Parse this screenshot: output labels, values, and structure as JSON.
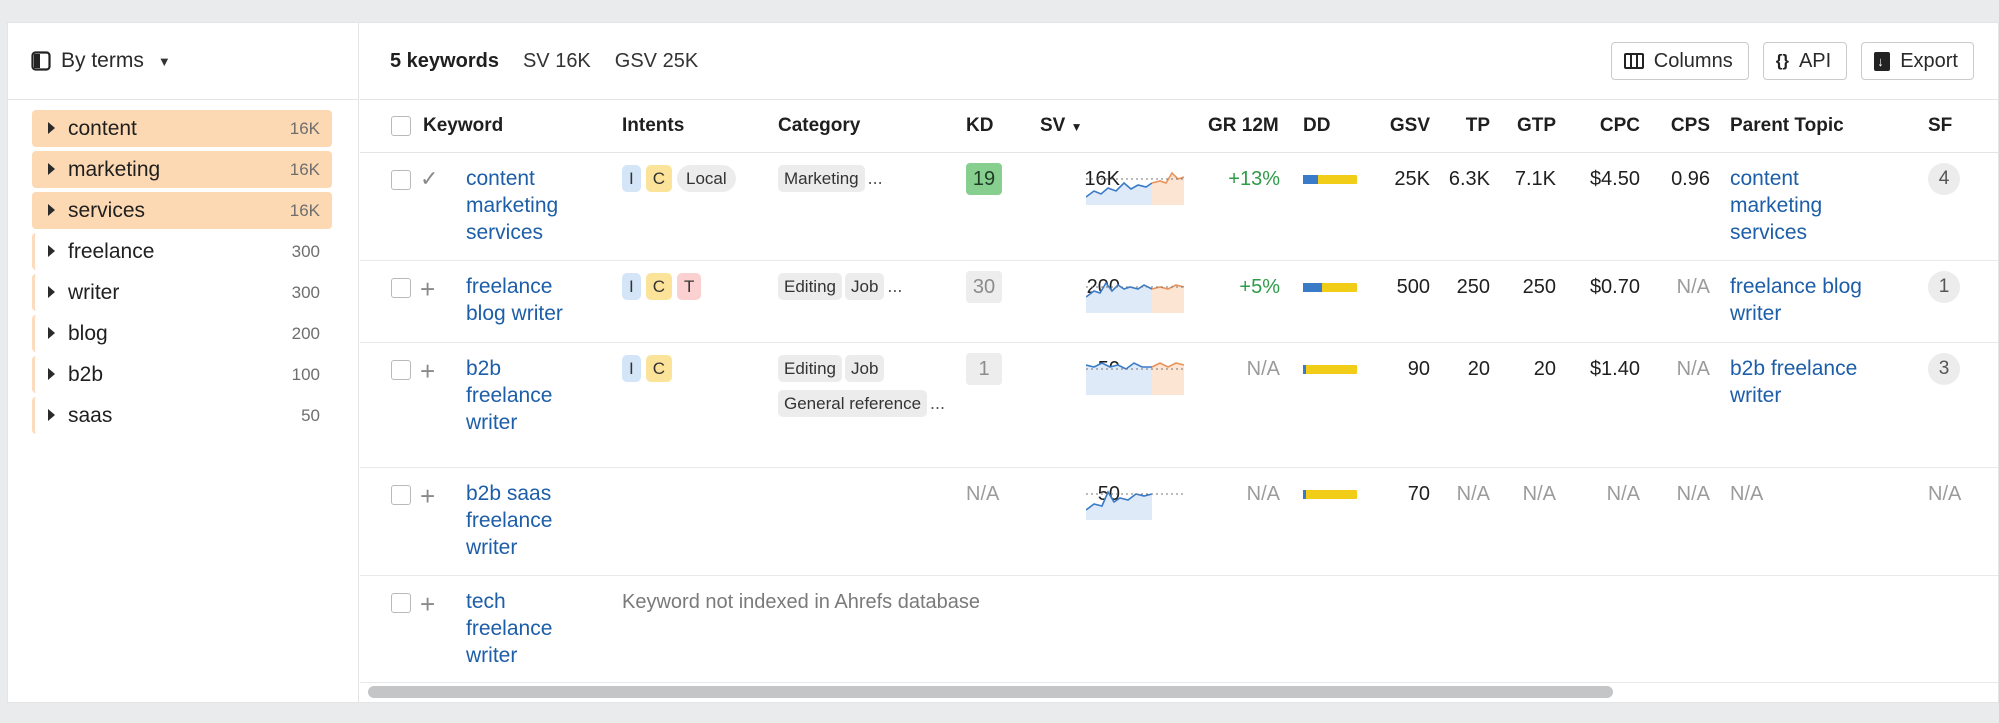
{
  "sidebar": {
    "view_label": "By terms",
    "terms": [
      {
        "name": "content",
        "count": "16K",
        "highlighted": true
      },
      {
        "name": "marketing",
        "count": "16K",
        "highlighted": true
      },
      {
        "name": "services",
        "count": "16K",
        "highlighted": true
      },
      {
        "name": "freelance",
        "count": "300",
        "highlighted": false
      },
      {
        "name": "writer",
        "count": "300",
        "highlighted": false
      },
      {
        "name": "blog",
        "count": "200",
        "highlighted": false
      },
      {
        "name": "b2b",
        "count": "100",
        "highlighted": false
      },
      {
        "name": "saas",
        "count": "50",
        "highlighted": false
      }
    ]
  },
  "header": {
    "keyword_count": "5 keywords",
    "sv_total": "SV 16K",
    "gsv_total": "GSV 25K",
    "buttons": {
      "columns": "Columns",
      "api": "API",
      "export": "Export"
    }
  },
  "columns": {
    "keyword": "Keyword",
    "intents": "Intents",
    "category": "Category",
    "kd": "KD",
    "sv": "SV",
    "gr": "GR 12M",
    "dd": "DD",
    "gsv": "GSV",
    "tp": "TP",
    "gtp": "GTP",
    "cpc": "CPC",
    "cps": "CPS",
    "parent": "Parent Topic",
    "sf": "SF"
  },
  "rows": [
    {
      "keyword": "content marketing services",
      "intents": [
        "I",
        "C",
        "Local"
      ],
      "categories": [
        "Marketing"
      ],
      "category_more": "...",
      "kd": "19",
      "sv": "16K",
      "gr": "+13%",
      "dd_blue_fraction": 0.27,
      "gsv": "25K",
      "tp": "6.3K",
      "gtp": "7.1K",
      "cpc": "$4.50",
      "cps": "0.96",
      "parent": "content marketing services",
      "sf": "4",
      "added": true
    },
    {
      "keyword": "freelance blog writer",
      "intents": [
        "I",
        "C",
        "T"
      ],
      "categories": [
        "Editing",
        "Job"
      ],
      "category_more": "...",
      "kd": "30",
      "sv": "200",
      "gr": "+5%",
      "dd_blue_fraction": 0.35,
      "gsv": "500",
      "tp": "250",
      "gtp": "250",
      "cpc": "$0.70",
      "cps": "N/A",
      "parent": "freelance blog writer",
      "sf": "1",
      "added": false
    },
    {
      "keyword": "b2b freelance writer",
      "intents": [
        "I",
        "C"
      ],
      "categories": [
        "Editing",
        "Job",
        "General reference"
      ],
      "category_more": "...",
      "kd": "1",
      "sv": "50",
      "gr": "N/A",
      "dd_blue_fraction": 0.05,
      "gsv": "90",
      "tp": "20",
      "gtp": "20",
      "cpc": "$1.40",
      "cps": "N/A",
      "parent": "b2b freelance writer",
      "sf": "3",
      "added": false
    },
    {
      "keyword": "b2b saas freelance writer",
      "intents": [],
      "categories": [],
      "kd": "N/A",
      "sv": "50",
      "gr": "N/A",
      "dd_blue_fraction": 0.05,
      "gsv": "70",
      "tp": "N/A",
      "gtp": "N/A",
      "cpc": "N/A",
      "cps": "N/A",
      "parent": "N/A",
      "sf": "N/A",
      "added": false
    },
    {
      "keyword": "tech freelance writer",
      "not_indexed": "Keyword not indexed in Ahrefs database",
      "added": false
    }
  ],
  "colors": {
    "highlight": "#fdd9b3",
    "link": "#1d5ea8",
    "positive": "#2e9b47",
    "kd_green": "#86cf8f",
    "dd_yellow": "#f2cd18",
    "dd_blue": "#3a7bc8"
  }
}
